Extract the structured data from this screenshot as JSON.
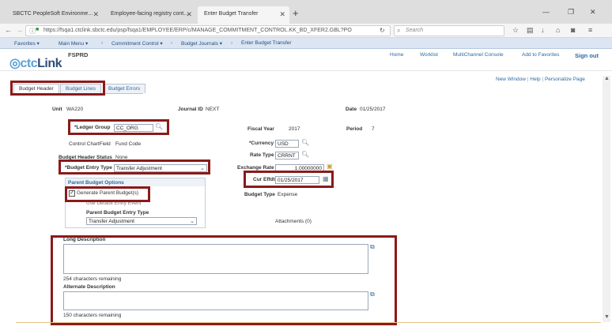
{
  "browser": {
    "tabs": [
      {
        "label": "SBCTC PeopleSoft Environme..."
      },
      {
        "label": "Employee-facing registry cont..."
      },
      {
        "label": "Enter Budget Transfer"
      }
    ],
    "url": "https://fsqa1.ctclink.sbctc.edu/psp/fsqa1/EMPLOYEE/ERP/c/MANAGE_COMMITMENT_CONTROL.KK_BD_XFER2.GBL?PO",
    "search_placeholder": "Search"
  },
  "nav": {
    "favorites": "Favorites ▾",
    "main_menu": "Main Menu ▾",
    "crumbs": [
      "Commitment Control ▾",
      "Budget Journals ▾",
      "Enter Budget Transfer"
    ]
  },
  "header": {
    "logo_prefix": "ctc",
    "logo_suffix": "Link",
    "env": "FSPRD",
    "links": [
      "Home",
      "Worklist",
      "MultiChannel Console",
      "Add to Favorites"
    ],
    "signout": "Sign out"
  },
  "page_links": {
    "new_window": "New Window",
    "help": "Help",
    "personalize": "Personalize Page"
  },
  "tabs": [
    "Budget Header",
    "Budget Lines",
    "Budget Errors"
  ],
  "form": {
    "unit_label": "Unit",
    "unit_value": "WA220",
    "journal_id_label": "Journal ID",
    "journal_id_value": "NEXT",
    "date_label": "Date",
    "date_value": "01/25/2017",
    "ledger_group_label": "*Ledger Group",
    "ledger_group_value": "CC_ORG",
    "fiscal_year_label": "Fiscal Year",
    "fiscal_year_value": "2017",
    "period_label": "Period",
    "period_value": "7",
    "control_chartfield_label": "Control ChartField",
    "control_chartfield_value": "Fund Code",
    "currency_label": "*Currency",
    "currency_value": "USD",
    "rate_type_label": "Rate Type",
    "rate_type_value": "CRRNT",
    "budget_header_status_label": "Budget Header Status",
    "budget_header_status_value": "None",
    "budget_entry_type_label": "*Budget Entry Type",
    "budget_entry_type_value": "Transfer Adjustment",
    "exchange_rate_label": "Exchange Rate",
    "exchange_rate_value": "1.00000000",
    "parent_budget_options_title": "Parent Budget Options",
    "generate_parent_label": "Generate Parent Budget(s)",
    "use_default_entry_label": "Use Default Entry Event",
    "parent_entry_type_label": "Parent Budget Entry Type",
    "parent_entry_type_value": "Transfer Adjustment",
    "cur_effdt_label": "Cur Effdt",
    "cur_effdt_value": "01/25/2017",
    "budget_type_label": "Budget Type",
    "budget_type_value": "Expense",
    "attachments": "Attachments (0)",
    "long_description_label": "Long Description",
    "long_description_remaining": "254 characters remaining",
    "alternate_description_label": "Alternate Description",
    "alternate_description_remaining": "150 characters remaining"
  },
  "colors": {
    "highlight_box": "#8b1a1a",
    "link": "#2c6aa0",
    "nav_bg": "#dbe6f2"
  }
}
